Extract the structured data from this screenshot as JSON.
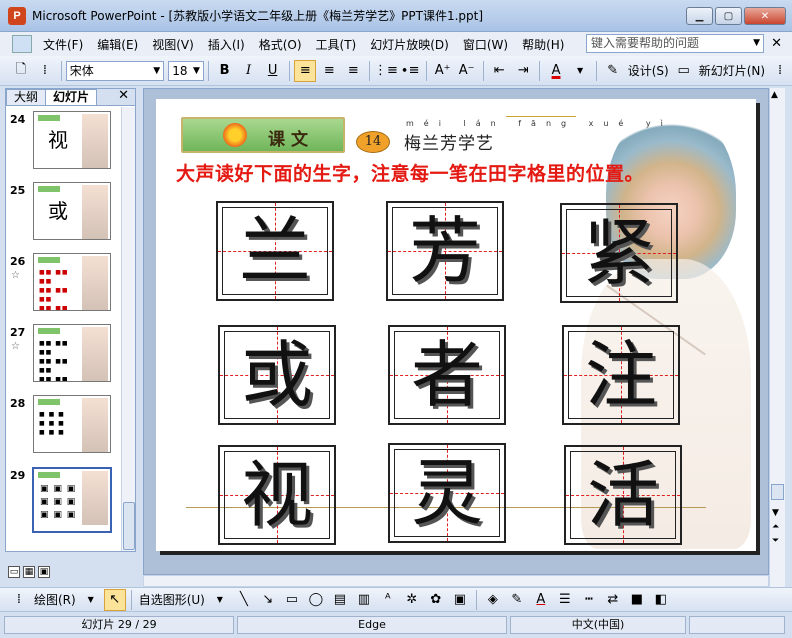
{
  "window": {
    "app_title": "Microsoft PowerPoint - [苏教版小学语文二年级上册《梅兰芳学艺》PPT课件1.ppt]"
  },
  "menu": {
    "items": [
      "文件(F)",
      "编辑(E)",
      "视图(V)",
      "插入(I)",
      "格式(O)",
      "工具(T)",
      "幻灯片放映(D)",
      "窗口(W)",
      "帮助(H)"
    ],
    "help_placeholder": "键入需要帮助的问题"
  },
  "toolbar": {
    "font_name": "宋体",
    "font_size": "18",
    "design_label": "设计(S)",
    "new_slide_label": "新幻灯片(N)"
  },
  "left_pane": {
    "tabs": [
      "大纲",
      "幻灯片"
    ],
    "active_tab": "幻灯片",
    "thumbnails": [
      {
        "num": "24",
        "char": "视",
        "star": false
      },
      {
        "num": "25",
        "char": "或",
        "star": false
      },
      {
        "num": "26",
        "char": "",
        "star": true
      },
      {
        "num": "27",
        "char": "",
        "star": true
      },
      {
        "num": "28",
        "char": "",
        "star": false
      },
      {
        "num": "29",
        "char": "",
        "star": false,
        "selected": true
      }
    ]
  },
  "slide": {
    "banner_label": "课文",
    "lesson_number": "14",
    "pinyin": "méi lán fāng xué yì",
    "lesson_title": "梅兰芳学艺",
    "instruction": "大声读好下面的生字，注意每一笔在田字格里的位置。",
    "characters": [
      "兰",
      "芳",
      "紧",
      "或",
      "者",
      "注",
      "视",
      "灵",
      "活"
    ]
  },
  "drawing_toolbar": {
    "draw_label": "绘图(R)",
    "autoshapes_label": "自选图形(U)"
  },
  "status": {
    "slide_pos": "幻灯片 29 / 29",
    "template": "Edge",
    "language": "中文(中国)"
  }
}
